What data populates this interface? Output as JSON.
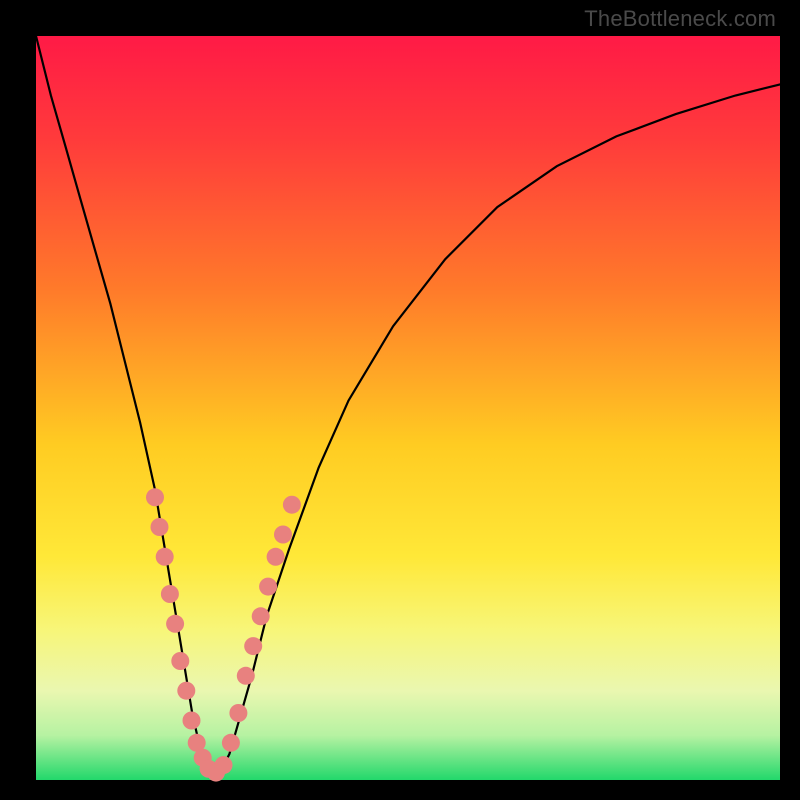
{
  "watermark": "TheBottleneck.com",
  "colors": {
    "frame": "#000000",
    "curve": "#000000",
    "dots": "#e8817f",
    "gradient_stops": [
      {
        "pct": 0,
        "color": "#ff1a46"
      },
      {
        "pct": 14,
        "color": "#ff3b3b"
      },
      {
        "pct": 34,
        "color": "#ff7a2a"
      },
      {
        "pct": 55,
        "color": "#ffcc22"
      },
      {
        "pct": 70,
        "color": "#ffe838"
      },
      {
        "pct": 80,
        "color": "#f7f67a"
      },
      {
        "pct": 88,
        "color": "#eaf7b0"
      },
      {
        "pct": 94,
        "color": "#b6f2a2"
      },
      {
        "pct": 100,
        "color": "#22d86b"
      }
    ]
  },
  "chart_data": {
    "type": "line",
    "title": "",
    "xlabel": "",
    "ylabel": "",
    "xlim": [
      0,
      100
    ],
    "ylim": [
      0,
      100
    ],
    "legend": false,
    "grid": false,
    "series": [
      {
        "name": "bottleneck-curve",
        "x": [
          0,
          2,
          4,
          6,
          8,
          10,
          12,
          14,
          16,
          18,
          19,
          20,
          21,
          22,
          23,
          24,
          25,
          26,
          27,
          29,
          31,
          34,
          38,
          42,
          48,
          55,
          62,
          70,
          78,
          86,
          94,
          100
        ],
        "y": [
          100,
          92,
          85,
          78,
          71,
          64,
          56,
          48,
          39,
          27,
          21,
          15,
          9,
          4.5,
          2,
          1,
          1.5,
          3.5,
          7,
          14,
          22,
          31,
          42,
          51,
          61,
          70,
          77,
          82.5,
          86.5,
          89.5,
          92,
          93.5
        ]
      }
    ],
    "scatter": {
      "name": "sample-dots",
      "points": [
        {
          "x": 16.0,
          "y": 38
        },
        {
          "x": 16.6,
          "y": 34
        },
        {
          "x": 17.3,
          "y": 30
        },
        {
          "x": 18.0,
          "y": 25
        },
        {
          "x": 18.7,
          "y": 21
        },
        {
          "x": 19.4,
          "y": 16
        },
        {
          "x": 20.2,
          "y": 12
        },
        {
          "x": 20.9,
          "y": 8
        },
        {
          "x": 21.6,
          "y": 5
        },
        {
          "x": 22.4,
          "y": 3
        },
        {
          "x": 23.2,
          "y": 1.5
        },
        {
          "x": 24.2,
          "y": 1
        },
        {
          "x": 25.2,
          "y": 2
        },
        {
          "x": 26.2,
          "y": 5
        },
        {
          "x": 27.2,
          "y": 9
        },
        {
          "x": 28.2,
          "y": 14
        },
        {
          "x": 29.2,
          "y": 18
        },
        {
          "x": 30.2,
          "y": 22
        },
        {
          "x": 31.2,
          "y": 26
        },
        {
          "x": 32.2,
          "y": 30
        },
        {
          "x": 33.2,
          "y": 33
        },
        {
          "x": 34.4,
          "y": 37
        }
      ],
      "r": 9
    }
  }
}
